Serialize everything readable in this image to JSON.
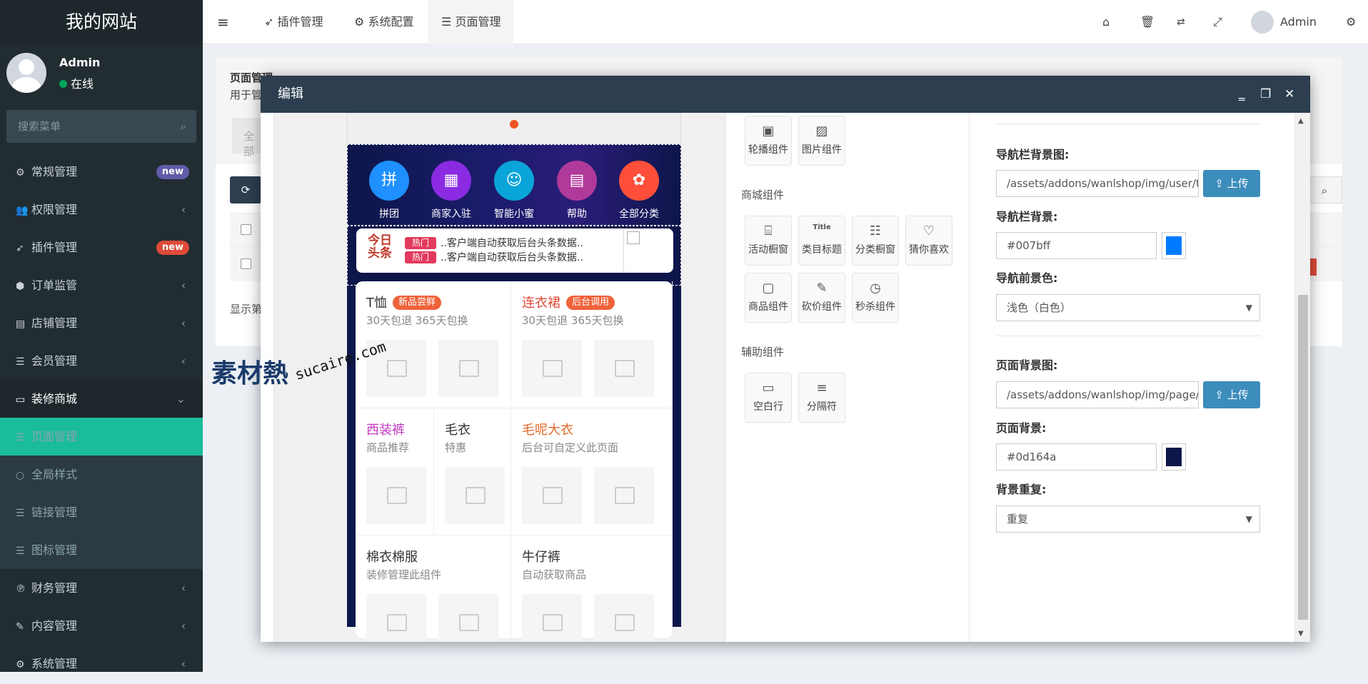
{
  "sidebar": {
    "logo": "我的网站",
    "user_name": "Admin",
    "user_status": "在线",
    "search_placeholder": "搜索菜单",
    "items": [
      {
        "label": "常规管理",
        "icon": "gears-icon",
        "badge": "new",
        "badge_color": "#605ca8"
      },
      {
        "label": "权限管理",
        "icon": "users-icon",
        "arrow": "‹"
      },
      {
        "label": "插件管理",
        "icon": "rocket-icon",
        "badge": "new",
        "badge_color": "#dd4b39"
      },
      {
        "label": "订单监管",
        "icon": "cube-icon",
        "arrow": "‹"
      },
      {
        "label": "店铺管理",
        "icon": "archive-icon",
        "arrow": "‹"
      },
      {
        "label": "会员管理",
        "icon": "list-icon",
        "arrow": "‹"
      },
      {
        "label": "装修商城",
        "icon": "desktop-icon",
        "arrow": "⌄"
      }
    ],
    "subitems": [
      {
        "label": "页面管理",
        "icon": "list-icon"
      },
      {
        "label": "全局样式",
        "icon": "circle-icon"
      },
      {
        "label": "链接管理",
        "icon": "list-icon"
      },
      {
        "label": "图标管理",
        "icon": "list-icon"
      }
    ],
    "items2": [
      {
        "label": "财务管理",
        "icon": "paypal-icon",
        "arrow": "‹"
      },
      {
        "label": "内容管理",
        "icon": "edit-icon",
        "arrow": "‹"
      },
      {
        "label": "系统管理",
        "icon": "gear-icon",
        "arrow": "‹"
      }
    ]
  },
  "topbar": {
    "tabs": [
      "插件管理",
      "系统配置",
      "页面管理"
    ],
    "admin_name": "Admin"
  },
  "page": {
    "title": "页面管理",
    "subtitle": "用于管",
    "tab_all": "全部",
    "footer_text": "显示第"
  },
  "modal": {
    "title": "编辑",
    "phone": {
      "nav_items": [
        {
          "label": "拼团",
          "color": "#1e90ff",
          "glyph": "拼"
        },
        {
          "label": "商家入驻",
          "color": "#8a2be2",
          "glyph": "▦"
        },
        {
          "label": "智能小蜜",
          "color": "#0aa5d8",
          "glyph": "☺"
        },
        {
          "label": "帮助",
          "color": "#b03a9a",
          "glyph": "▤"
        },
        {
          "label": "全部分类",
          "color": "#ff4f3a",
          "glyph": "✿"
        }
      ],
      "news_logo_line1": "今日",
      "news_logo_line2": "头条",
      "news_tag": "热门",
      "news_lines": [
        "..客户端自动获取后台头条数据..",
        "..客户端自动获取后台头条数据.."
      ],
      "cells": [
        {
          "title": "T恤",
          "title_color": "#333333",
          "tag": "新品尝鲜",
          "tag_color": "#f0623a",
          "sub": "30天包退 365天包换"
        },
        {
          "title": "连衣裙",
          "title_color": "#e04a3a",
          "tag": "后台调用",
          "tag_color": "#f0623a",
          "sub": "30天包退 365天包换"
        },
        {
          "title": "西装裤",
          "title_color": "#c03ac0",
          "sub": "商品推荐"
        },
        {
          "title": "毛衣",
          "title_color": "#333333",
          "sub": "特惠"
        },
        {
          "title": "毛呢大衣",
          "title_color": "#e06a2a",
          "sub": "后台可自定义此页面"
        },
        {
          "title": "棉衣棉服",
          "title_color": "#333333",
          "sub": "装修管理此组件"
        },
        {
          "title": "牛仔裤",
          "title_color": "#333333",
          "sub": "自动获取商品"
        }
      ]
    },
    "watermark": {
      "main": "素材熱",
      "site": "sucaire.com"
    },
    "components": {
      "top_buttons": [
        {
          "label": "轮播组件",
          "icon": "slider-icon",
          "glyph": "▣"
        },
        {
          "label": "图片组件",
          "icon": "image-icon",
          "glyph": "▨"
        }
      ],
      "shop_title": "商城组件",
      "shop_buttons": [
        {
          "label": "活动橱窗",
          "icon": "gift-icon",
          "glyph": "⌸"
        },
        {
          "label": "类目标题",
          "icon": "title-icon",
          "glyph": "Title"
        },
        {
          "label": "分类橱窗",
          "icon": "grid-icon",
          "glyph": "☷"
        },
        {
          "label": "猜你喜欢",
          "icon": "heart-icon",
          "glyph": "♡"
        },
        {
          "label": "商品组件",
          "icon": "box-icon",
          "glyph": "▢"
        },
        {
          "label": "砍价组件",
          "icon": "cut-icon",
          "glyph": "✎"
        },
        {
          "label": "秒杀组件",
          "icon": "clock-icon",
          "glyph": "◷"
        }
      ],
      "aux_title": "辅助组件",
      "aux_buttons": [
        {
          "label": "空白行",
          "icon": "blank-icon",
          "glyph": "▭"
        },
        {
          "label": "分隔符",
          "icon": "divider-icon",
          "glyph": "≡"
        }
      ]
    },
    "form": {
      "nav_bg_image_label": "导航栏背景图:",
      "nav_bg_image_value": "/assets/addons/wanlshop/img/user/top",
      "upload_label": "上传",
      "nav_bg_label": "导航栏背景:",
      "nav_bg_value": "#007bff",
      "nav_fg_label": "导航前景色:",
      "nav_fg_value": "浅色（白色）",
      "page_bg_image_label": "页面背景图:",
      "page_bg_image_value": "/assets/addons/wanlshop/img/page/bg",
      "page_bg_label": "页面背景:",
      "page_bg_value": "#0d164a",
      "bg_repeat_label": "背景重复:",
      "bg_repeat_value": "重复"
    }
  }
}
